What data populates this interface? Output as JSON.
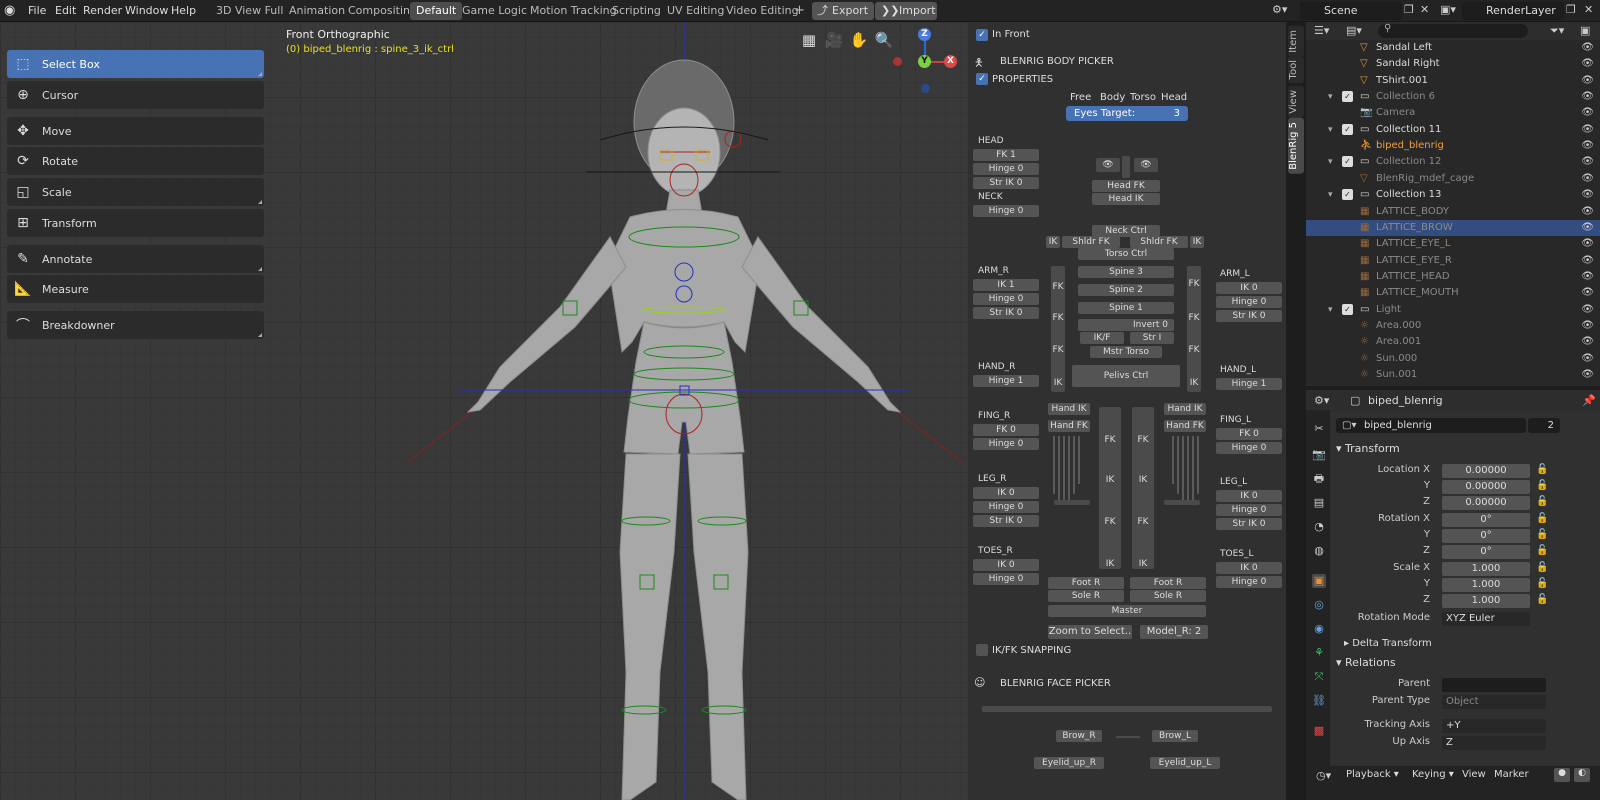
{
  "menu": [
    "File",
    "Edit",
    "Render",
    "Window",
    "Help"
  ],
  "workspaces": [
    "3D View Full",
    "Animation",
    "Compositing",
    "Default",
    "Game Logic",
    "Motion Tracking",
    "Scripting",
    "UV Editing",
    "Video Editing"
  ],
  "active_workspace": "Default",
  "add_workspace": "+",
  "export_label": "Export",
  "import_label": "Import",
  "scene": "Scene",
  "render_layer": "RenderLayer",
  "tools": [
    "Select Box",
    "Cursor",
    "Move",
    "Rotate",
    "Scale",
    "Transform",
    "Annotate",
    "Measure",
    "Breakdowner"
  ],
  "viewport": {
    "view_name": "Front Orthographic",
    "object_info": "(0) biped_blenrig : spine_3_ik_ctrl"
  },
  "sidebar_tabs": [
    "Item",
    "Tool",
    "View",
    "BlenRig 5"
  ],
  "picker": {
    "in_front": "In Front",
    "body_picker": "BLENRIG BODY PICKER",
    "properties": "PROPERTIES",
    "modes": [
      "Free",
      "Body",
      "Torso",
      "Head"
    ],
    "eyes_target": "Eyes Target:",
    "eyes_target_val": "3",
    "head": {
      "label": "HEAD",
      "items": [
        "FK 1",
        "Hinge 0",
        "Str IK 0"
      ]
    },
    "neck": {
      "label": "NECK",
      "items": [
        "Hinge 0"
      ]
    },
    "arm_r": {
      "label": "ARM_R",
      "items": [
        "IK 1",
        "Hinge 0",
        "Str IK 0"
      ]
    },
    "arm_l": {
      "label": "ARM_L",
      "items": [
        "IK 0",
        "Hinge 0",
        "Str IK 0"
      ]
    },
    "hand_r": {
      "label": "HAND_R",
      "items": [
        "Hinge 1"
      ]
    },
    "hand_l": {
      "label": "HAND_L",
      "items": [
        "Hinge 1"
      ]
    },
    "fing_r": {
      "label": "FING_R",
      "items": [
        "FK 0",
        "Hinge 0"
      ]
    },
    "fing_l": {
      "label": "FING_L",
      "items": [
        "FK 0",
        "Hinge 0"
      ]
    },
    "leg_r": {
      "label": "LEG_R",
      "items": [
        "IK 0",
        "Hinge 0",
        "Str IK 0"
      ]
    },
    "leg_l": {
      "label": "LEG_L",
      "items": [
        "IK 0",
        "Hinge 0",
        "Str IK 0"
      ]
    },
    "toes_r": {
      "label": "TOES_R",
      "items": [
        "IK 0",
        "Hinge 0"
      ]
    },
    "toes_l": {
      "label": "TOES_L",
      "items": [
        "IK 0",
        "Hinge 0"
      ]
    },
    "center": {
      "head_fk": "Head FK",
      "head_ik": "Head IK",
      "neck_ctrl": "Neck Ctrl",
      "shldr_fk_l": "Shldr FK",
      "shldr_fk_r": "Shldr FK",
      "ik": "IK",
      "torso_ctrl": "Torso Ctrl",
      "spine3": "Spine 3",
      "spine2": "Spine 2",
      "spine1": "Spine 1",
      "invert": "Invert 0",
      "ikf": "IK/F",
      "stri": "Str I",
      "mstr_torso": "Mstr Torso",
      "pelvis": "Pelivs Ctrl",
      "fk": "FK",
      "hand_ik": "Hand IK",
      "hand_fk": "Hand FK",
      "foot_r": "Foot R",
      "foot_r2": "Foot R",
      "sole_r": "Sole R",
      "sole_r2": "Sole R",
      "master": "Master",
      "zoom": "Zoom to Select..",
      "model": "Model_R: 2"
    },
    "ikfk_snapping": "IK/FK SNAPPING",
    "face_picker": "BLENRIG FACE PICKER",
    "brow_r": "Brow_R",
    "brow_l": "Brow_L",
    "eyelid_r": "Eyelid_up_R",
    "eyelid_l": "Eyelid_up_L"
  },
  "outliner": [
    {
      "name": "Sandal Left",
      "indent": 3,
      "dim": false,
      "type": "mesh"
    },
    {
      "name": "Sandal Right",
      "indent": 3,
      "dim": false,
      "type": "mesh"
    },
    {
      "name": "TShirt.001",
      "indent": 3,
      "dim": false,
      "type": "mesh"
    },
    {
      "name": "Collection 6",
      "indent": 1,
      "dim": true,
      "type": "coll"
    },
    {
      "name": "Camera",
      "indent": 3,
      "dim": true,
      "type": "cam"
    },
    {
      "name": "Collection 11",
      "indent": 1,
      "dim": false,
      "type": "coll"
    },
    {
      "name": "biped_blenrig",
      "indent": 3,
      "dim": false,
      "type": "arm",
      "active": true
    },
    {
      "name": "Collection 12",
      "indent": 1,
      "dim": true,
      "type": "coll"
    },
    {
      "name": "BlenRig_mdef_cage",
      "indent": 3,
      "dim": true,
      "type": "mesh"
    },
    {
      "name": "Collection 13",
      "indent": 1,
      "dim": false,
      "type": "coll"
    },
    {
      "name": "LATTICE_BODY",
      "indent": 3,
      "dim": true,
      "type": "lat"
    },
    {
      "name": "LATTICE_BROW",
      "indent": 3,
      "dim": true,
      "type": "lat",
      "selected": true
    },
    {
      "name": "LATTICE_EYE_L",
      "indent": 3,
      "dim": true,
      "type": "lat"
    },
    {
      "name": "LATTICE_EYE_R",
      "indent": 3,
      "dim": true,
      "type": "lat"
    },
    {
      "name": "LATTICE_HEAD",
      "indent": 3,
      "dim": true,
      "type": "lat"
    },
    {
      "name": "LATTICE_MOUTH",
      "indent": 3,
      "dim": true,
      "type": "lat"
    },
    {
      "name": "Light",
      "indent": 1,
      "dim": true,
      "type": "coll"
    },
    {
      "name": "Area.000",
      "indent": 3,
      "dim": true,
      "type": "light"
    },
    {
      "name": "Area.001",
      "indent": 3,
      "dim": true,
      "type": "light"
    },
    {
      "name": "Sun.000",
      "indent": 3,
      "dim": true,
      "type": "light"
    },
    {
      "name": "Sun.001",
      "indent": 3,
      "dim": true,
      "type": "light"
    }
  ],
  "props": {
    "object_name": "biped_blenrig",
    "data_name": "biped_blenrig",
    "users": "2",
    "transform": "Transform",
    "location_x_label": "Location X",
    "location_x": "0.00000",
    "location_y_label": "Y",
    "location_y": "0.00000",
    "location_z_label": "Z",
    "location_z": "0.00000",
    "rotation_x_label": "Rotation X",
    "rotation_x": "0°",
    "rotation_y_label": "Y",
    "rotation_y": "0°",
    "rotation_z_label": "Z",
    "rotation_z": "0°",
    "scale_x_label": "Scale X",
    "scale_x": "1.000",
    "scale_y_label": "Y",
    "scale_y": "1.000",
    "scale_z_label": "Z",
    "scale_z": "1.000",
    "rotation_mode_label": "Rotation Mode",
    "rotation_mode": "XYZ Euler",
    "delta_transform": "Delta Transform",
    "relations": "Relations",
    "parent_label": "Parent",
    "parent_type_label": "Parent Type",
    "parent_type": "Object",
    "tracking_axis_label": "Tracking Axis",
    "tracking_axis": "+Y",
    "up_axis_label": "Up Axis",
    "up_axis": "Z"
  },
  "timeline": [
    "Playback",
    "Keying",
    "View",
    "Marker"
  ]
}
